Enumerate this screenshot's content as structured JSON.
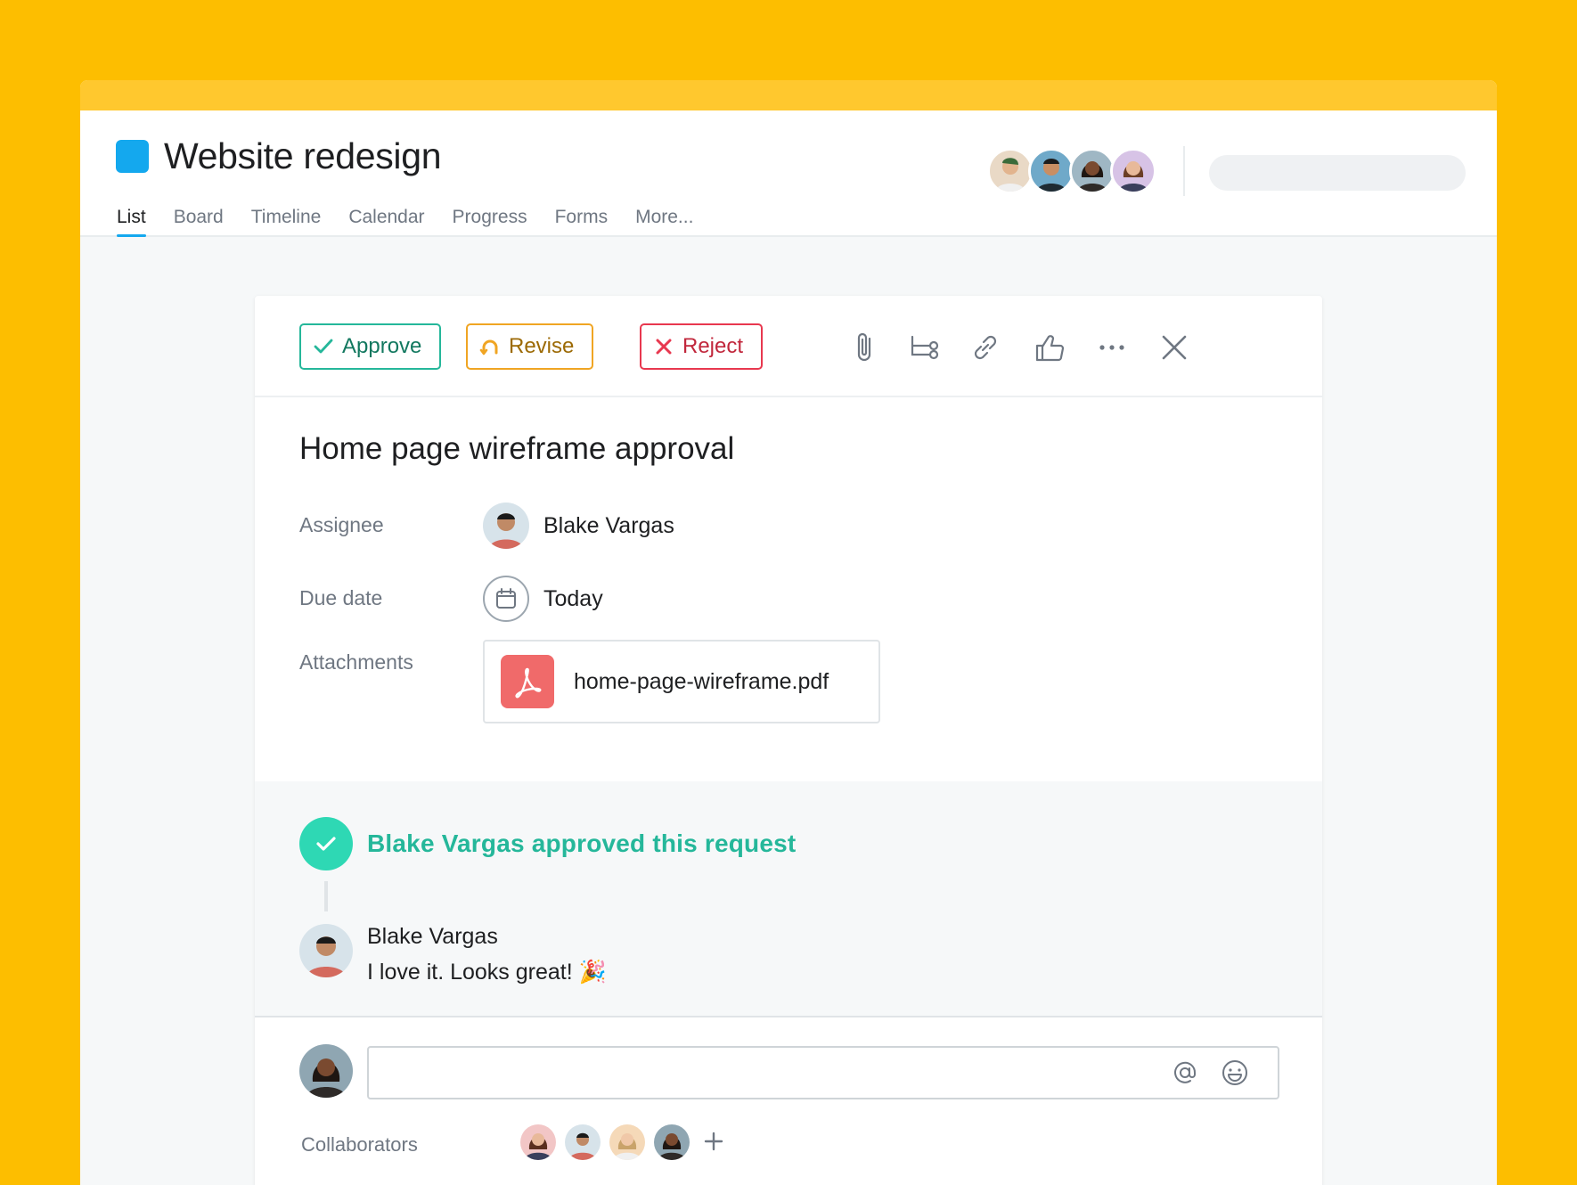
{
  "project": {
    "title": "Website redesign",
    "color": "#14A8EE"
  },
  "tabs": [
    "List",
    "Board",
    "Timeline",
    "Calendar",
    "Progress",
    "Forms",
    "More..."
  ],
  "active_tab": "List",
  "search": {
    "placeholder": ""
  },
  "members": [
    {
      "icon": "avatar-member-1",
      "bg": "#E9D9C6"
    },
    {
      "icon": "avatar-member-2",
      "bg": "#6FA9C9"
    },
    {
      "icon": "avatar-member-3",
      "bg": "#9FB7C4"
    },
    {
      "icon": "avatar-member-4",
      "bg": "#D7C3E6"
    }
  ],
  "toolbar": {
    "approve_label": "Approve",
    "revise_label": "Revise",
    "reject_label": "Reject",
    "icons": [
      "paperclip-icon",
      "subtask-icon",
      "link-icon",
      "thumbs-up-icon",
      "more-icon",
      "close-icon"
    ]
  },
  "task": {
    "title": "Home page wireframe approval",
    "assignee_label": "Assignee",
    "assignee_name": "Blake Vargas",
    "due_label": "Due date",
    "due_value": "Today",
    "attachments_label": "Attachments",
    "attachment_name": "home-page-wireframe.pdf"
  },
  "activity": {
    "approval_text": "Blake Vargas approved this request",
    "comment_author": "Blake Vargas",
    "comment_text": "I love it. Looks great! 🎉"
  },
  "composer": {
    "placeholder": "",
    "collaborators_label": "Collaborators"
  },
  "colors": {
    "approve": "#25B79A",
    "revise": "#F0A523",
    "reject": "#E8384F",
    "background": "#FDBE00"
  }
}
